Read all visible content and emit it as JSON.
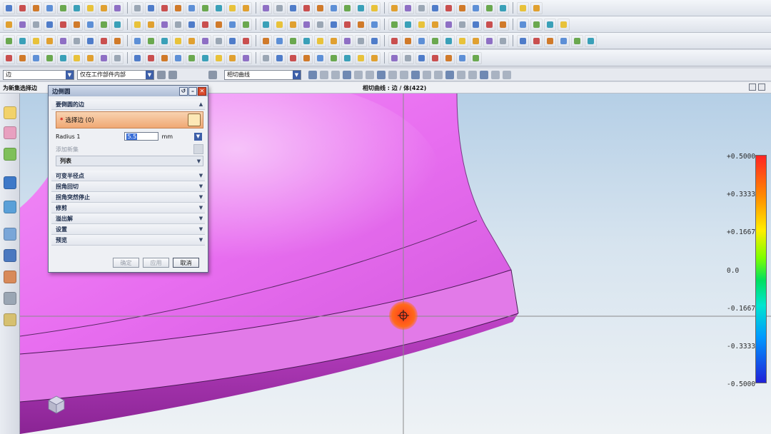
{
  "status_bar": {
    "prompt": "为新集选择边",
    "selection_info": "相切曲线 : 边 / 体(422)"
  },
  "selection_bar": {
    "type_filter": "边",
    "scope": "仅在工作部件内部",
    "curve_rule": "相切曲线"
  },
  "dialog": {
    "title": "边倒圆",
    "edges_section": "要倒圆的边",
    "select_edge": "选择边 (0)",
    "radius_label": "Radius 1",
    "radius_value": "5.5",
    "radius_unit": "mm",
    "add_new_set": "添加新集",
    "list_label": "列表",
    "sections": [
      "可变半径点",
      "拐角回切",
      "拐角突然停止",
      "修剪",
      "溢出解",
      "设置",
      "预览"
    ],
    "ok": "确定",
    "apply": "应用",
    "cancel": "取消"
  },
  "legend": {
    "labels": [
      "+0.5000",
      "+0.3333",
      "+0.1667",
      "0.0",
      "-0.1667",
      "-0.3333",
      "-0.5000"
    ]
  },
  "colors": {
    "model_face": "#e86ef0",
    "model_side": "#a030a8",
    "selection_highlight": "#ff5a14"
  },
  "icons": {
    "toolbar": "cad-tool-icons",
    "resource_bar": "navigator-icons"
  }
}
